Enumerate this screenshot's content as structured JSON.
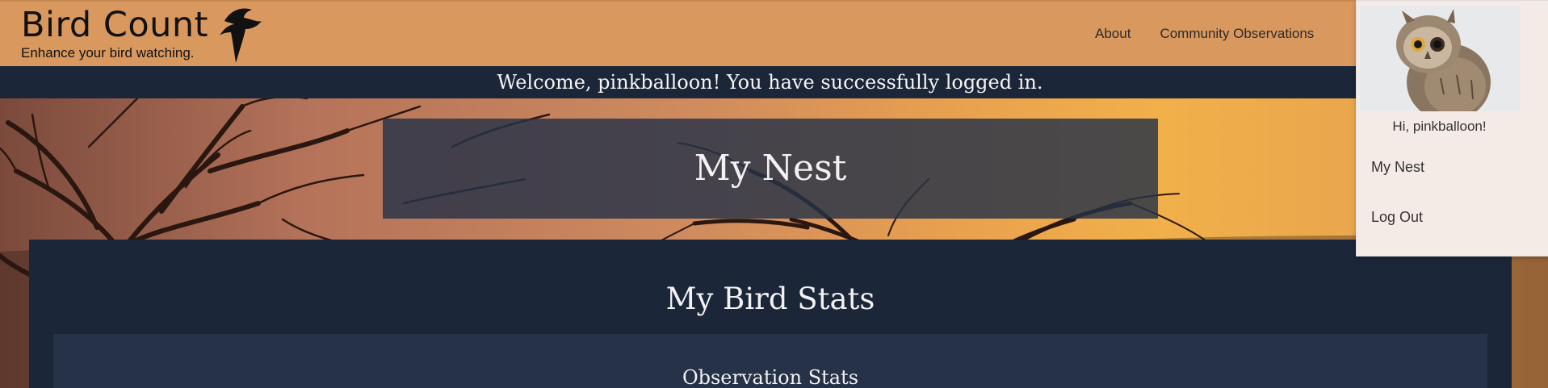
{
  "header": {
    "brand_title": "Bird Count",
    "brand_tagline": "Enhance your bird watching.",
    "logo_icon": "bird-silhouette-icon",
    "nav": [
      {
        "label": "About"
      },
      {
        "label": "Community Observations"
      }
    ]
  },
  "welcome": {
    "message": "Welcome, pinkballoon! You have successfully logged in."
  },
  "hero": {
    "title": "My Nest"
  },
  "main": {
    "section_title": "My Bird Stats",
    "card_title": "Observation Stats"
  },
  "user_menu": {
    "avatar": "owl-photo",
    "greeting": "Hi, pinkballoon!",
    "items": [
      {
        "label": "My Nest"
      },
      {
        "label": "Log Out"
      }
    ]
  },
  "colors": {
    "header_bg": "#d9995e",
    "navy": "#1b2638",
    "card_bg": "#253248",
    "menu_bg": "#f4ebe6"
  }
}
